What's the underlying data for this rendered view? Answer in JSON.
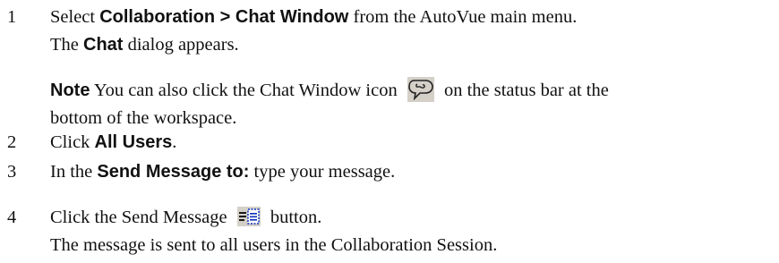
{
  "steps": [
    {
      "number": "1",
      "lead": "Select ",
      "bold": "Collaboration > Chat Window",
      "tail": " from the AutoVue main menu.",
      "result_pre": "The ",
      "result_bold": "Chat",
      "result_post": " dialog appears."
    },
    {
      "number": "2",
      "lead": "Click ",
      "bold": "All Users",
      "tail": "."
    },
    {
      "number": "3",
      "lead": "In the ",
      "bold": "Send Message to:",
      "tail": " type your message."
    },
    {
      "number": "4",
      "lead": "Click the Send Message ",
      "tail": " button.",
      "result": "The message is sent to all users in the Collaboration Session."
    }
  ],
  "note": {
    "label": "Note",
    "text_before_icon": "  You can also click the Chat Window icon ",
    "text_after_icon": " on the status bar at the",
    "line2": "bottom of the workspace."
  },
  "icons": {
    "chat_window": "chat-bubble-icon",
    "send_message": "send-message-icon",
    "icon_background": "#d4d0c8"
  }
}
